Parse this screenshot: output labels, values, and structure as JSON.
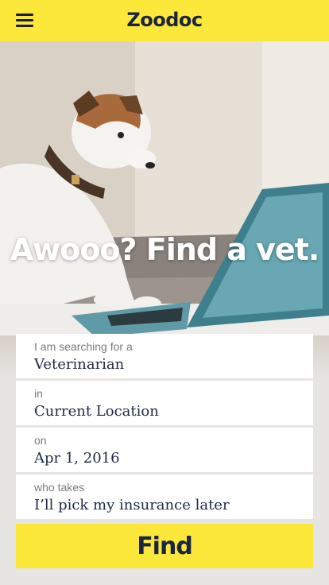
{
  "header": {
    "brand": "Zoodoc",
    "brand_color": "#fce83a",
    "menu_icon": "hamburger-menu-icon"
  },
  "hero": {
    "headline": "Awooo? Find a vet.",
    "image": "jack-russell-terrier-with-laptop"
  },
  "search": {
    "fields": [
      {
        "label": "I am searching for a",
        "value": "Veterinarian"
      },
      {
        "label": "in",
        "value": "Current Location"
      },
      {
        "label": "on",
        "value": "Apr 1, 2016"
      },
      {
        "label": "who takes",
        "value": "I’ll pick my insurance later"
      }
    ],
    "submit_label": "Find"
  }
}
